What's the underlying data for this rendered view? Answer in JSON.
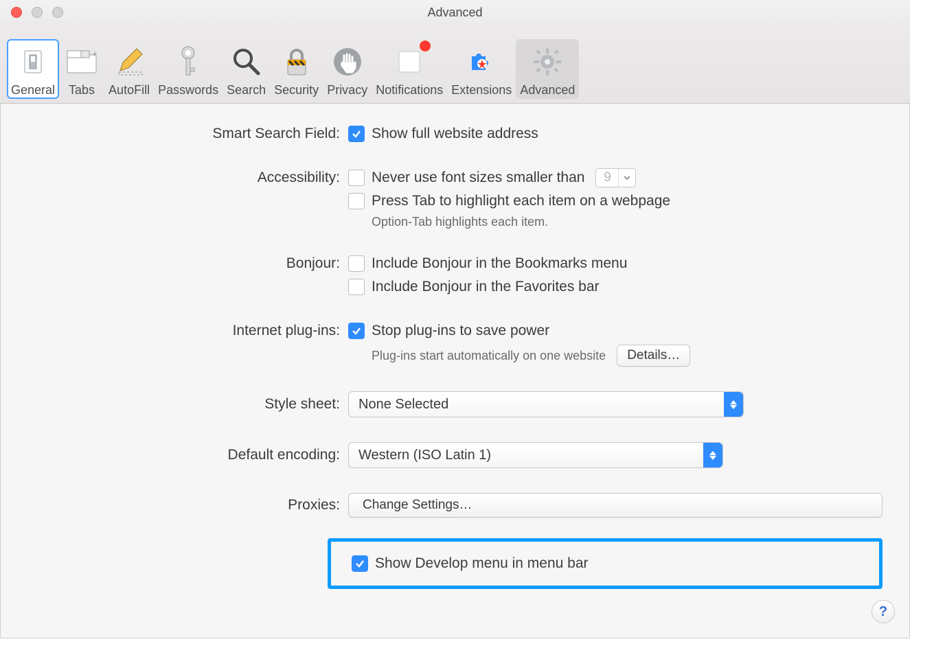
{
  "window": {
    "title": "Advanced"
  },
  "toolbar": {
    "items": [
      {
        "name": "general",
        "label": "General"
      },
      {
        "name": "tabs",
        "label": "Tabs"
      },
      {
        "name": "autofill",
        "label": "AutoFill"
      },
      {
        "name": "passwords",
        "label": "Passwords"
      },
      {
        "name": "search",
        "label": "Search"
      },
      {
        "name": "security",
        "label": "Security"
      },
      {
        "name": "privacy",
        "label": "Privacy"
      },
      {
        "name": "notifications",
        "label": "Notifications"
      },
      {
        "name": "extensions",
        "label": "Extensions"
      },
      {
        "name": "advanced",
        "label": "Advanced"
      }
    ]
  },
  "sections": {
    "smart_search": {
      "label": "Smart Search Field:",
      "show_full_addr": "Show full website address",
      "show_full_addr_checked": true
    },
    "accessibility": {
      "label": "Accessibility:",
      "font_size": "Never use font sizes smaller than",
      "font_size_value": "9",
      "font_size_checked": false,
      "press_tab": "Press Tab to highlight each item on a webpage",
      "press_tab_checked": false,
      "option_tab_note": "Option-Tab highlights each item."
    },
    "bonjour": {
      "label": "Bonjour:",
      "bookmarks": "Include Bonjour in the Bookmarks menu",
      "bookmarks_checked": false,
      "favorites": "Include Bonjour in the Favorites bar",
      "favorites_checked": false
    },
    "plugins": {
      "label": "Internet plug-ins:",
      "stop": "Stop plug-ins to save power",
      "stop_checked": true,
      "auto_note": "Plug-ins start automatically on one website",
      "details_btn": "Details…"
    },
    "stylesheet": {
      "label": "Style sheet:",
      "value": "None Selected"
    },
    "encoding": {
      "label": "Default encoding:",
      "value": "Western (ISO Latin 1)"
    },
    "proxies": {
      "label": "Proxies:",
      "button": "Change Settings…"
    },
    "develop": {
      "label": "Show Develop menu in menu bar",
      "checked": true
    }
  },
  "help": "?"
}
